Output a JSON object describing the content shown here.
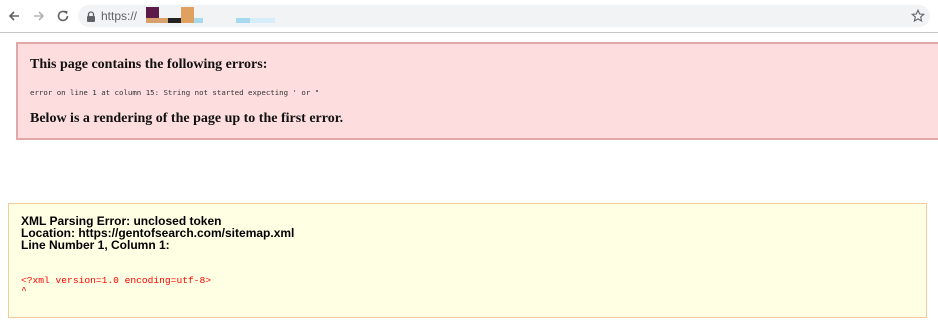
{
  "browser": {
    "url_prefix": "https://",
    "icons": {
      "back": "arrow-left-icon",
      "forward": "arrow-right-icon",
      "reload": "reload-icon",
      "lock": "lock-icon",
      "bookmark": "star-icon"
    }
  },
  "error_box": {
    "title": "This page contains the following errors:",
    "detail": "error on line 1 at column 15: String not started expecting ' or \"",
    "rendering_note": "Below is a rendering of the page up to the first error.",
    "background": "#fddddd",
    "border": "#e0a8a8"
  },
  "xml_error": {
    "title": "XML Parsing Error: unclosed token",
    "location": "Location: https://gentofsearch.com/sitemap.xml",
    "line": "Line Number 1, Column 1:",
    "source_line": "<?xml version=1.0 encoding=utf-8>",
    "caret": "^",
    "background": "#ffffe3",
    "border": "#f1cc9a",
    "source_color": "#ff0000"
  }
}
